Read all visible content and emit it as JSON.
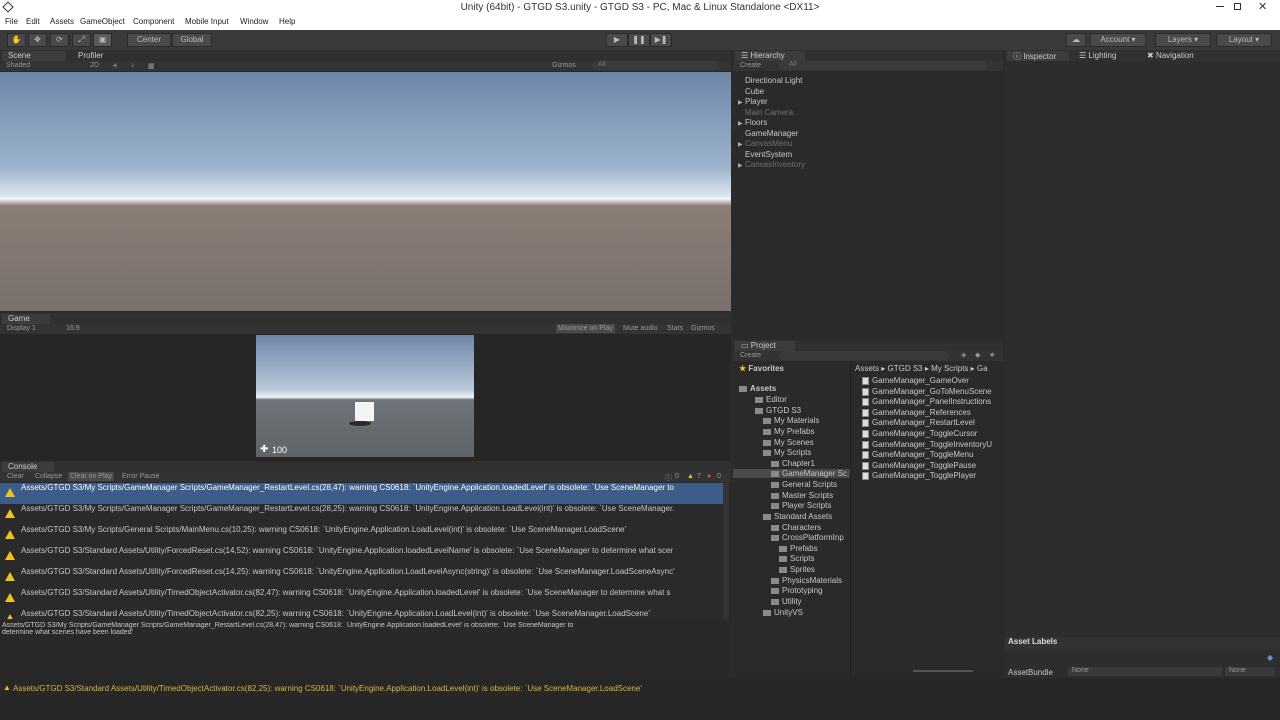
{
  "window": {
    "title": "Unity (64bit) - GTGD S3.unity - GTGD S3 - PC, Mac & Linux Standalone <DX11>"
  },
  "menu": [
    "File",
    "Edit",
    "Assets",
    "GameObject",
    "Component",
    "Mobile Input",
    "Window",
    "Help"
  ],
  "toolbar": {
    "center": "Center",
    "global": "Global",
    "account": "Account",
    "layers": "Layers",
    "layout": "Layout"
  },
  "scene": {
    "tab": "Scene",
    "profiler": "Profiler",
    "shaded": "Shaded",
    "mode2d": "2D",
    "gizmos": "Gizmos",
    "search": "All"
  },
  "game": {
    "tab": "Game",
    "display": "Display 1",
    "aspect": "16:9",
    "maximize": "Maximize on Play",
    "mute": "Mute audio",
    "stats": "Stats",
    "gizmos": "Gizmos",
    "health": "100"
  },
  "hierarchy": {
    "tab": "Hierarchy",
    "create": "Create",
    "search": "All",
    "items": [
      {
        "label": "Directional Light",
        "dim": false,
        "arrow": false
      },
      {
        "label": "Cube",
        "dim": false,
        "arrow": false
      },
      {
        "label": "Player",
        "dim": false,
        "arrow": true
      },
      {
        "label": "Main Camera",
        "dim": true,
        "arrow": false
      },
      {
        "label": "Floors",
        "dim": false,
        "arrow": true
      },
      {
        "label": "GameManager",
        "dim": false,
        "arrow": false
      },
      {
        "label": "CanvasMenu",
        "dim": true,
        "arrow": true
      },
      {
        "label": "EventSystem",
        "dim": false,
        "arrow": false
      },
      {
        "label": "CanvasInventory",
        "dim": true,
        "arrow": true
      }
    ]
  },
  "inspector": {
    "tab": "Inspector",
    "lighting": "Lighting",
    "navigation": "Navigation",
    "asset_labels": "Asset Labels",
    "asset_bundle": "AssetBundle",
    "none1": "None",
    "none2": "None"
  },
  "project": {
    "tab": "Project",
    "create": "Create",
    "favorites": "Favorites",
    "breadcrumb": [
      "Assets",
      "GTGD S3",
      "My Scripts",
      "Ga"
    ],
    "tree": [
      {
        "label": "Assets",
        "indent": 0,
        "bold": true
      },
      {
        "label": "Editor",
        "indent": 1
      },
      {
        "label": "GTGD S3",
        "indent": 1
      },
      {
        "label": "My Materials",
        "indent": 2
      },
      {
        "label": "My Prefabs",
        "indent": 2
      },
      {
        "label": "My Scenes",
        "indent": 2
      },
      {
        "label": "My Scripts",
        "indent": 2
      },
      {
        "label": "Chapter1",
        "indent": 3
      },
      {
        "label": "GameManager Sc",
        "indent": 3,
        "sel": true
      },
      {
        "label": "General Scripts",
        "indent": 3
      },
      {
        "label": "Master Scripts",
        "indent": 3
      },
      {
        "label": "Player Scripts",
        "indent": 3
      },
      {
        "label": "Standard Assets",
        "indent": 1
      },
      {
        "label": "Characters",
        "indent": 2
      },
      {
        "label": "CrossPlatformInp",
        "indent": 2
      },
      {
        "label": "Prefabs",
        "indent": 3
      },
      {
        "label": "Scripts",
        "indent": 3
      },
      {
        "label": "Sprites",
        "indent": 3
      },
      {
        "label": "PhysicsMaterials",
        "indent": 2
      },
      {
        "label": "Prototyping",
        "indent": 2
      },
      {
        "label": "Utility",
        "indent": 2
      },
      {
        "label": "UnityVS",
        "indent": 1
      }
    ],
    "files": [
      "GameManager_GameOver",
      "GameManager_GoToMenuScene",
      "GameManager_PanelInstructions",
      "GameManager_References",
      "GameManager_RestartLevel",
      "GameManager_ToggleCursor",
      "GameManager_ToggleInventoryU",
      "GameManager_ToggleMenu",
      "GameManager_TogglePause",
      "GameManager_TogglePlayer"
    ]
  },
  "console": {
    "tab": "Console",
    "clear": "Clear",
    "collapse": "Collapse",
    "clear_on_play": "Clear on Play",
    "error_pause": "Error Pause",
    "count_info": "0",
    "count_warn": "7",
    "count_err": "0",
    "rows": [
      "Assets/GTGD S3/My Scripts/GameManager Scripts/GameManager_RestartLevel.cs(28,47): warning CS0618: `UnityEngine.Application.loadedLevel' is obsolete: `Use SceneManager to",
      "Assets/GTGD S3/My Scripts/GameManager Scripts/GameManager_RestartLevel.cs(28,25): warning CS0618: `UnityEngine.Application.LoadLevel(int)' is obsolete: `Use SceneManager.",
      "Assets/GTGD S3/My Scripts/General Scripts/MainMenu.cs(10,25): warning CS0618: `UnityEngine.Application.LoadLevel(int)' is obsolete: `Use SceneManager.LoadScene'",
      "Assets/GTGD S3/Standard Assets/Utility/ForcedReset.cs(14,52): warning CS0618: `UnityEngine.Application.loadedLevelName' is obsolete: `Use SceneManager to determine what scer",
      "Assets/GTGD S3/Standard Assets/Utility/ForcedReset.cs(14,25): warning CS0618: `UnityEngine.Application.LoadLevelAsync(string)' is obsolete: `Use SceneManager.LoadSceneAsync'",
      "Assets/GTGD S3/Standard Assets/Utility/TimedObjectActivator.cs(82,47): warning CS0618: `UnityEngine.Application.loadedLevel' is obsolete: `Use SceneManager to determine what s",
      "Assets/GTGD S3/Standard Assets/Utility/TimedObjectActivator.cs(82,25): warning CS0618: `UnityEngine.Application.LoadLevel(int)' is obsolete: `Use SceneManager.LoadScene'"
    ],
    "detail_line1": "Assets/GTGD S3/My Scripts/GameManager Scripts/GameManager_RestartLevel.cs(28,47): warning CS0618: `UnityEngine.Application.loadedLevel' is obsolete: `Use SceneManager to",
    "detail_line2": "determine what scenes have been loaded'"
  },
  "statusbar": {
    "text": "Assets/GTGD S3/Standard Assets/Utility/TimedObjectActivator.cs(82,25): warning CS0618: `UnityEngine.Application.LoadLevel(int)' is obsolete: `Use SceneManager.LoadScene'"
  },
  "colors": {
    "accent": "#3d5c8a",
    "warning": "#f0c21f",
    "status_text": "#d9b43a"
  }
}
